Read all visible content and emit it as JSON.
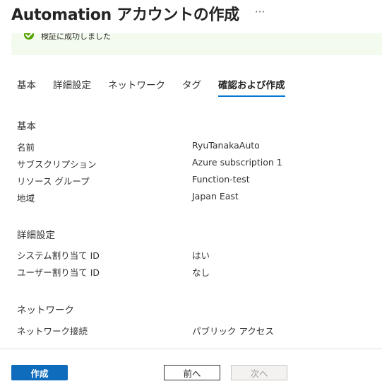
{
  "header": {
    "title": "Automation アカウントの作成",
    "more": "···"
  },
  "banner": {
    "message": "検証に成功しました",
    "icon": "success-check-icon",
    "accent": "#57a300"
  },
  "tabs": [
    {
      "label": "基本"
    },
    {
      "label": "詳細設定"
    },
    {
      "label": "ネットワーク"
    },
    {
      "label": "タグ"
    },
    {
      "label": "確認および作成",
      "active": true
    }
  ],
  "basics": {
    "title": "基本",
    "rows": [
      {
        "label": "名前",
        "value": "RyuTanakaAuto"
      },
      {
        "label": "サブスクリプション",
        "value": "Azure subscription 1"
      },
      {
        "label": "リソース グループ",
        "value": "Function-test"
      },
      {
        "label": "地域",
        "value": "Japan East"
      }
    ]
  },
  "advanced": {
    "title": "詳細設定",
    "rows": [
      {
        "label": "システム割り当て ID",
        "value": "はい"
      },
      {
        "label": "ユーザー割り当て ID",
        "value": "なし"
      }
    ]
  },
  "network": {
    "title": "ネットワーク",
    "rows": [
      {
        "label": "ネットワーク接続",
        "value": "パブリック アクセス"
      }
    ]
  },
  "footer": {
    "create_label": "作成",
    "prev_label": "前へ",
    "next_label": "次へ",
    "primary_color": "#0f6cbd"
  }
}
